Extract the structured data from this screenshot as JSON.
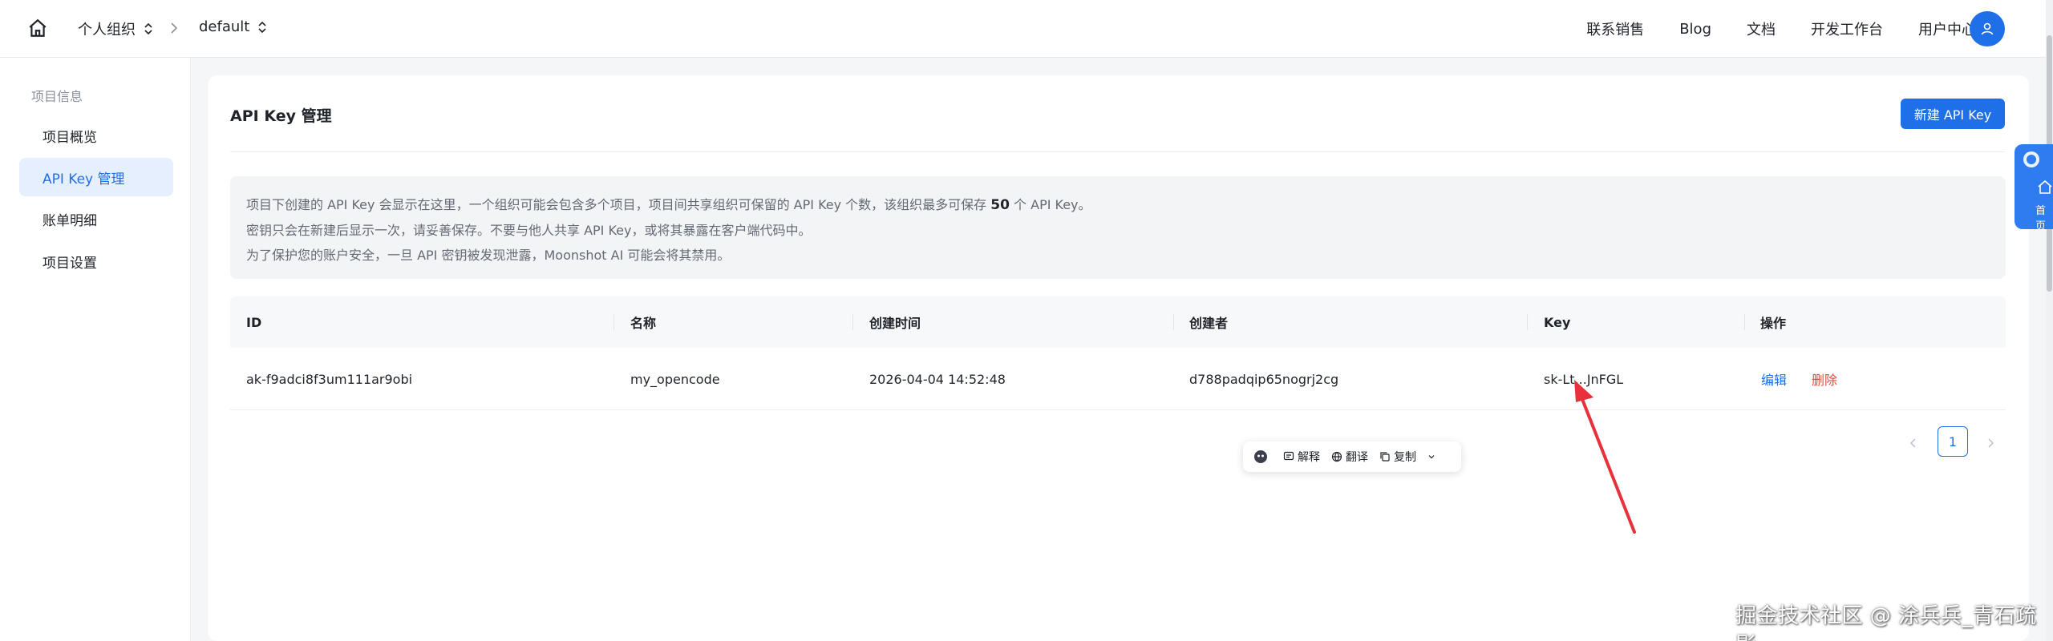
{
  "topbar": {
    "org": "个人组织",
    "project": "default",
    "links": [
      "联系销售",
      "Blog",
      "文档",
      "开发工作台",
      "用户中心"
    ]
  },
  "sidebar": {
    "heading": "项目信息",
    "items": [
      {
        "label": "项目概览"
      },
      {
        "label": "API Key 管理"
      },
      {
        "label": "账单明细"
      },
      {
        "label": "项目设置"
      }
    ]
  },
  "main": {
    "title": "API Key 管理",
    "new_button": "新建 API Key",
    "notice": {
      "line1_pre": "项目下创建的 API Key 会显示在这里，一个组织可能会包含多个项目，项目间共享组织可保留的 API Key 个数，该组织最多可保存",
      "line1_num": "50",
      "line1_post": "个 API Key。",
      "line2": "密钥只会在新建后显示一次，请妥善保存。不要与他人共享 API Key，或将其暴露在客户端代码中。",
      "line3": "为了保护您的账户安全，一旦 API 密钥被发现泄露，Moonshot AI 可能会将其禁用。"
    },
    "table": {
      "headers": [
        "ID",
        "名称",
        "创建时间",
        "创建者",
        "Key",
        "操作"
      ],
      "rows": [
        {
          "id": "ak-f9adci8f3um111ar9obi",
          "name": "my_opencode",
          "created": "2026-04-04 14:52:48",
          "creator": "d788padqip65nogrj2cg",
          "key": "sk-Lt...JnFGL",
          "edit": "编辑",
          "delete": "删除"
        }
      ]
    },
    "pagination": {
      "current": "1"
    }
  },
  "selection_toolbar": {
    "explain": "解释",
    "translate": "翻译",
    "copy": "复制"
  },
  "float_widget": {
    "label": "首页"
  },
  "annotation": {
    "arrow_color": "#e8313a"
  },
  "watermark": "掘金技术社区 @ 涂兵兵_青石疏影",
  "colors": {
    "primary": "#1f6fe8",
    "danger": "#e2473e",
    "active_bg": "#e5effd"
  }
}
